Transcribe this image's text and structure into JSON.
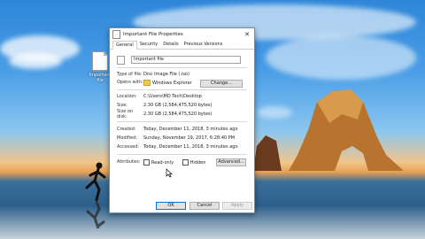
{
  "desktop": {
    "file_icon_label": "Important file"
  },
  "dialog": {
    "title": "Important File Properties",
    "tabs": [
      "General",
      "Security",
      "Details",
      "Previous Versions"
    ],
    "filename": "Important file",
    "type_label": "Type of file:",
    "type_value": "Disc Image File (.iso)",
    "opens_label": "Opens with:",
    "opens_value": "Windows Explorer",
    "change_label": "Change...",
    "location_label": "Location:",
    "location_value": "C:\\Users\\MD Tech\\Desktop",
    "size_label": "Size:",
    "size_value": "2.30 GB (2,584,475,520 bytes)",
    "sizeondisk_label": "Size on disk:",
    "sizeondisk_value": "2.30 GB (2,584,475,520 bytes)",
    "created_label": "Created:",
    "created_value": "Today, December 11, 2018, 3 minutes ago",
    "modified_label": "Modified:",
    "modified_value": "Sunday, November 19, 2017, 6:28:40 PM",
    "accessed_label": "Accessed:",
    "accessed_value": "Today, December 11, 2018, 3 minutes ago",
    "attributes_label": "Attributes:",
    "readonly_label": "Read-only",
    "hidden_label": "Hidden",
    "advanced_label": "Advanced...",
    "ok_label": "OK",
    "cancel_label": "Cancel",
    "apply_label": "Apply"
  }
}
